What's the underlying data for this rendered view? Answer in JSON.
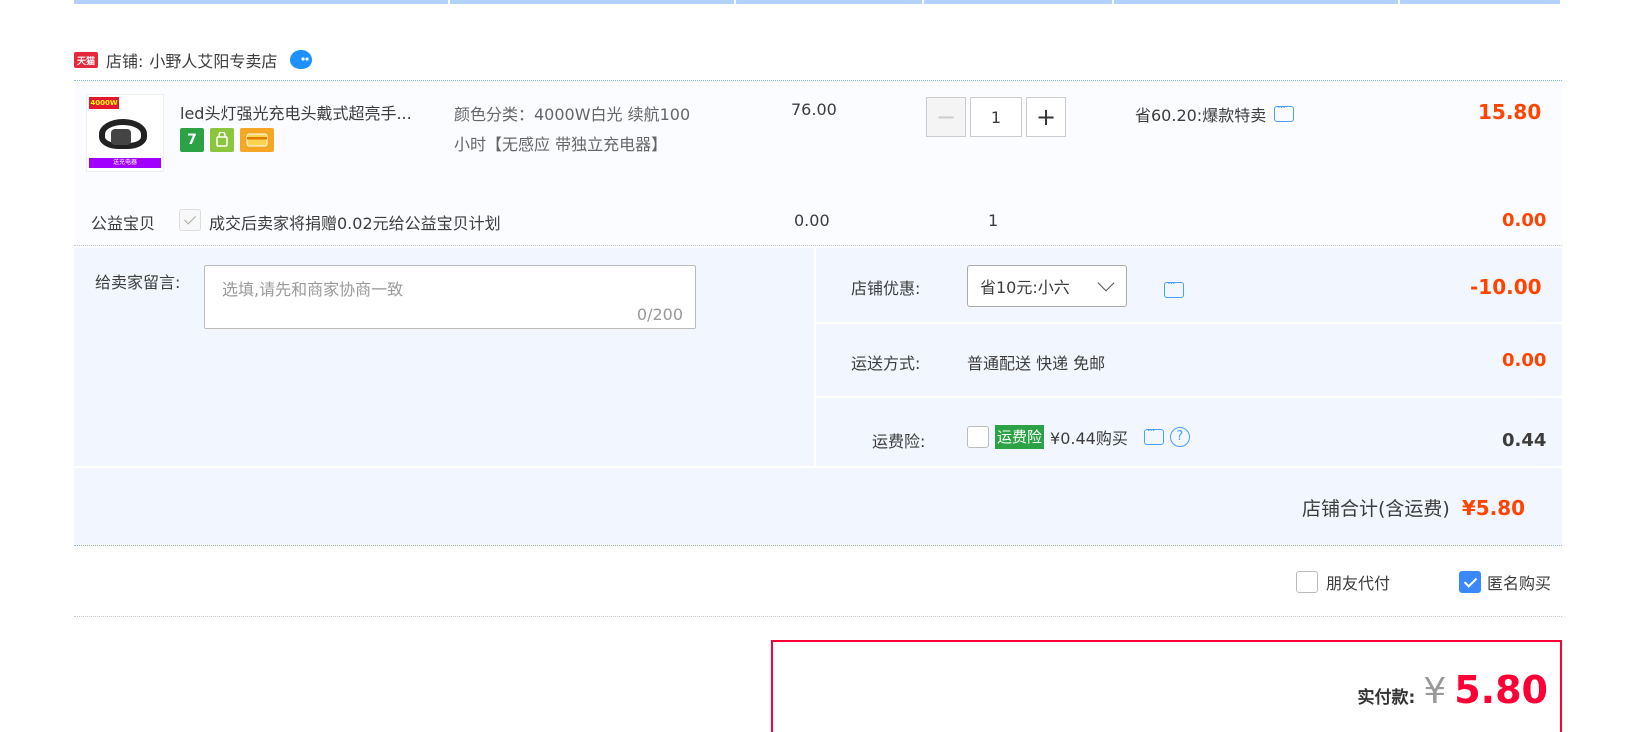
{
  "shop": {
    "tmall_badge": "天猫",
    "label": "店铺:",
    "name": "小野人艾阳专卖店"
  },
  "product": {
    "thumb_top_text": "4000W",
    "thumb_bottom_text": "送充电器",
    "title": "led头灯强光充电头戴式超亮手...",
    "badge_7": "7",
    "sku_line1": "颜色分类：4000W白光 续航100",
    "sku_line2": "小时【无感应 带独立充电器】",
    "unit_price": "76.00",
    "qty": "1",
    "minus": "−",
    "plus": "+",
    "promo": "省60.20:爆款特卖",
    "subtotal": "15.80"
  },
  "charity": {
    "label": "公益宝贝",
    "text": "成交后卖家将捐赠0.02元给公益宝贝计划",
    "price": "0.00",
    "qty": "1",
    "subtotal": "0.00"
  },
  "message": {
    "label": "给卖家留言:",
    "placeholder": "选填,请先和商家协商一致",
    "counter": "0/200"
  },
  "discount": {
    "label": "店铺优惠:",
    "selected": "省10元:小六",
    "amount": "-10.00"
  },
  "shipping": {
    "label": "运送方式:",
    "value": "普通配送 快递 免邮",
    "amount": "0.00"
  },
  "insurance": {
    "label": "运费险:",
    "tag": "运费险",
    "text": "¥0.44购买",
    "help": "?",
    "amount": "0.44"
  },
  "shop_total": {
    "label": "店铺合计(含运费)",
    "amount": "¥5.80"
  },
  "options": {
    "friend_pay": "朋友代付",
    "anonymous": "匿名购买"
  },
  "payment": {
    "label": "实付款:",
    "currency": "¥",
    "amount": "5.80"
  },
  "colors": {
    "accent_red": "#ff0036",
    "price_red": "#f40",
    "panel_blue": "#f2f7ff",
    "checkbox_blue": "#3a88fd"
  }
}
